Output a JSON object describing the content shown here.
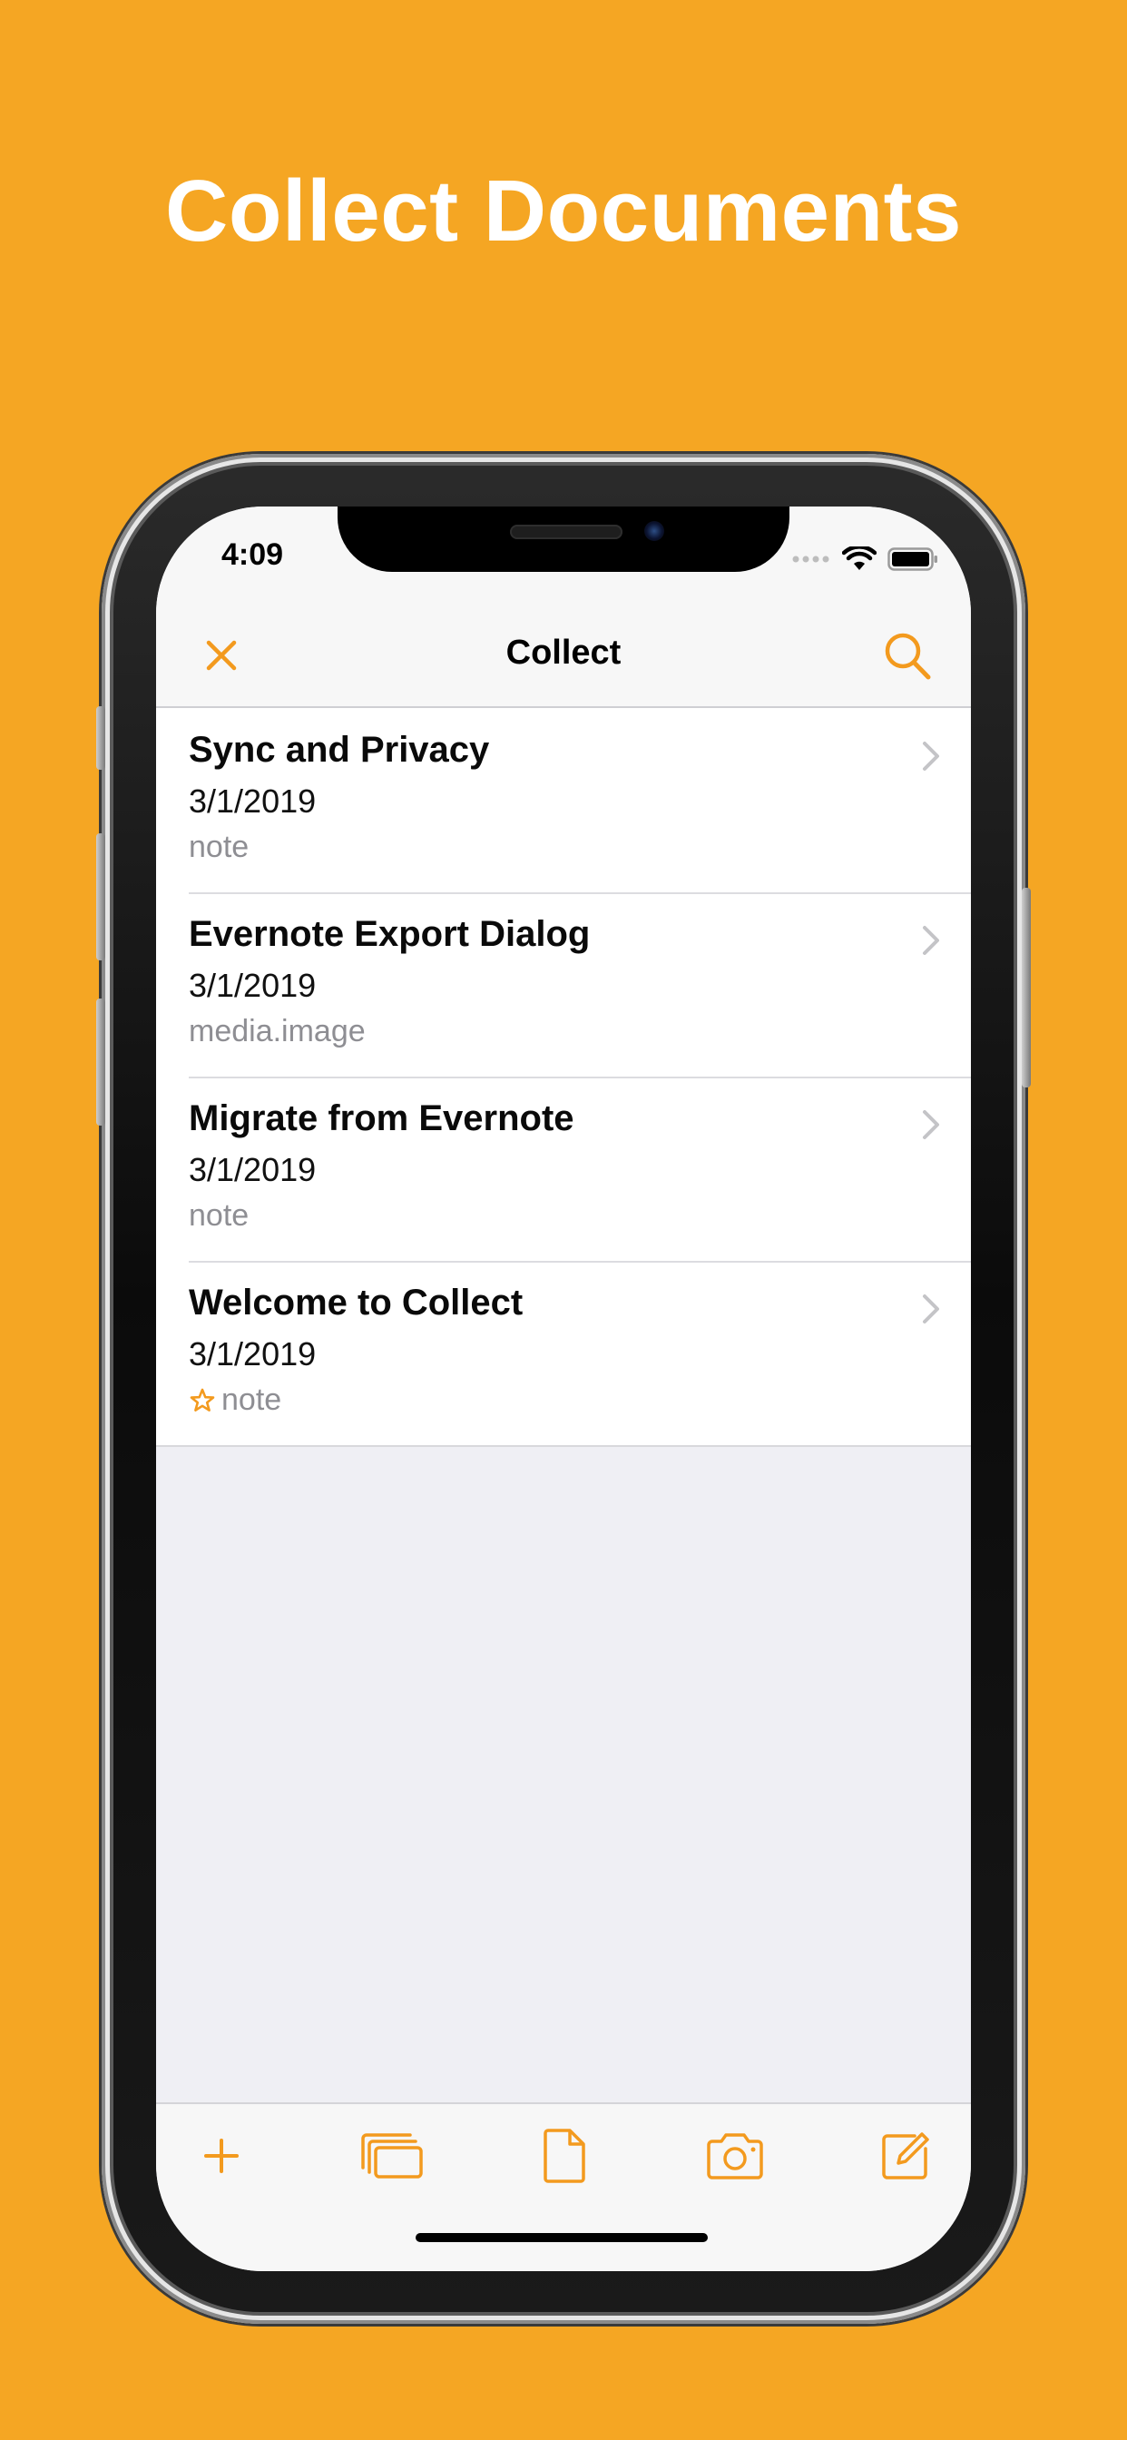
{
  "headline": "Collect Documents",
  "status_bar": {
    "time": "4:09"
  },
  "nav": {
    "title": "Collect",
    "left_icon": "close-icon",
    "right_icon": "search-icon"
  },
  "documents": [
    {
      "title": "Sync and Privacy",
      "date": "3/1/2019",
      "type": "note",
      "starred": false
    },
    {
      "title": "Evernote Export Dialog",
      "date": "3/1/2019",
      "type": "media.image",
      "starred": false
    },
    {
      "title": "Migrate from Evernote",
      "date": "3/1/2019",
      "type": "note",
      "starred": false
    },
    {
      "title": "Welcome to Collect",
      "date": "3/1/2019",
      "type": "note",
      "starred": true
    }
  ],
  "toolbar": {
    "items": [
      "add-icon",
      "collections-icon",
      "document-icon",
      "camera-icon",
      "compose-icon"
    ]
  },
  "colors": {
    "background": "#F5A623",
    "accent": "#F39A1E",
    "secondary_text": "#8E8E93"
  }
}
